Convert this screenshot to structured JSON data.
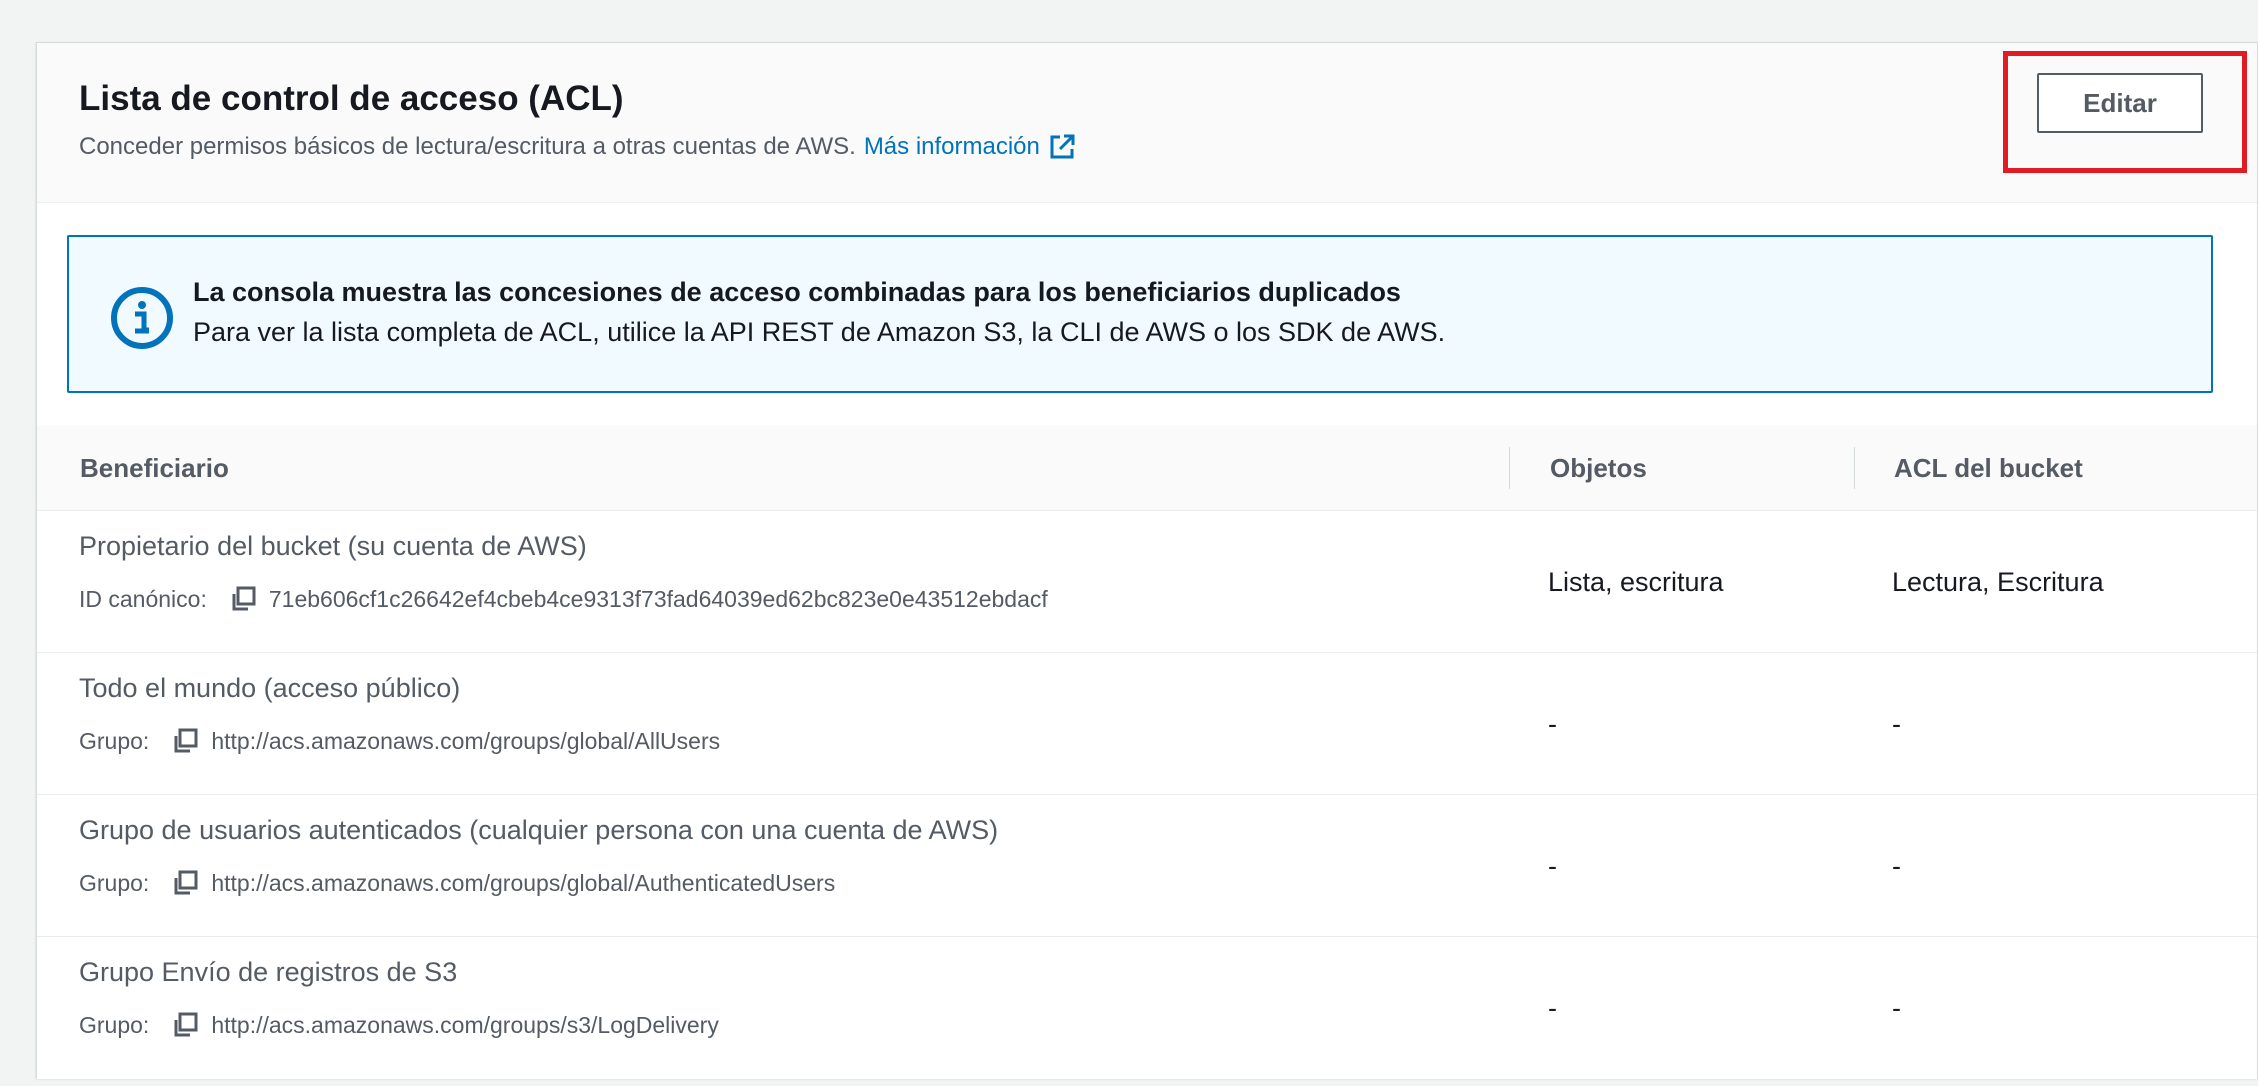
{
  "header": {
    "title": "Lista de control de acceso (ACL)",
    "description": "Conceder permisos básicos de lectura/escritura a otras cuentas de AWS.",
    "more_info_link": "Más información",
    "edit_button": "Editar"
  },
  "info_alert": {
    "title": "La consola muestra las concesiones de acceso combinadas para los beneficiarios duplicados",
    "text": "Para ver la lista completa de ACL, utilice la API REST de Amazon S3, la CLI de AWS o los SDK de AWS."
  },
  "table": {
    "columns": [
      "Beneficiario",
      "Objetos",
      "ACL del bucket"
    ],
    "rows": [
      {
        "name": "Propietario del bucket (su cuenta de AWS)",
        "id_label": "ID canónico:",
        "id_value": "71eb606cf1c26642ef4cbeb4ce9313f73fad64039ed62bc823e0e43512ebdacf",
        "objects": "Lista, escritura",
        "bucket_acl": "Lectura, Escritura"
      },
      {
        "name": "Todo el mundo (acceso público)",
        "id_label": "Grupo:",
        "id_value": "http://acs.amazonaws.com/groups/global/AllUsers",
        "objects": "-",
        "bucket_acl": "-"
      },
      {
        "name": "Grupo de usuarios autenticados (cualquier persona con una cuenta de AWS)",
        "id_label": "Grupo:",
        "id_value": "http://acs.amazonaws.com/groups/global/AuthenticatedUsers",
        "objects": "-",
        "bucket_acl": "-"
      },
      {
        "name": "Grupo Envío de registros de S3",
        "id_label": "Grupo:",
        "id_value": "http://acs.amazonaws.com/groups/s3/LogDelivery",
        "objects": "-",
        "bucket_acl": "-"
      }
    ]
  },
  "colors": {
    "link": "#0073bb",
    "info_border": "#0073bb",
    "info_background": "#f1faff",
    "highlight": "#e01b24"
  },
  "icons": [
    "external-link-icon",
    "info-icon",
    "copy-icon"
  ]
}
